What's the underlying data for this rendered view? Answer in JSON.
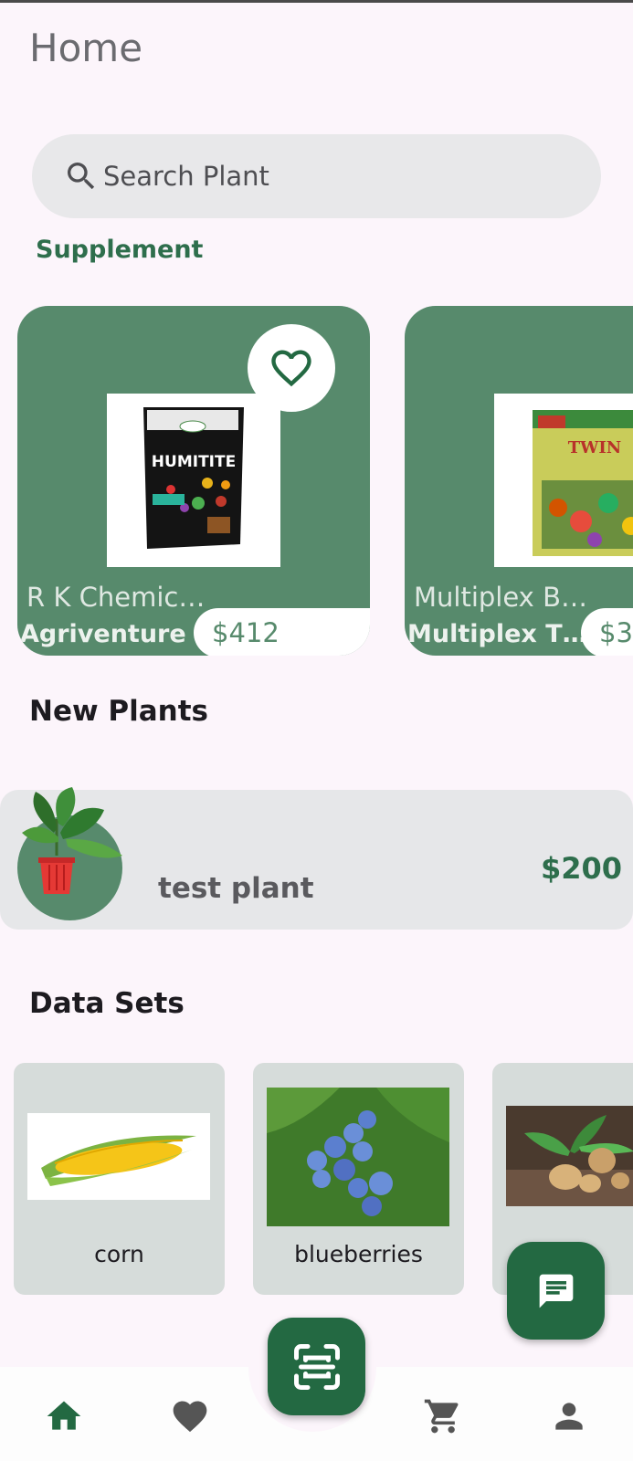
{
  "header": {
    "title": "Home"
  },
  "search": {
    "placeholder": "Search Plant"
  },
  "supplement": {
    "label": "Supplement",
    "cards": [
      {
        "brand": "R K Chemic…",
        "name": "Agriventure …",
        "price": "$412",
        "image_text": "HUMITITE"
      },
      {
        "brand": "Multiplex B…",
        "name": "Multiplex T…",
        "price": "$3",
        "image_text": "TWIN"
      }
    ]
  },
  "new_plants": {
    "label": "New Plants",
    "items": [
      {
        "name": "test plant",
        "price": "$200"
      }
    ]
  },
  "data_sets": {
    "label": "Data Sets",
    "items": [
      {
        "name": "corn"
      },
      {
        "name": "blueberries"
      },
      {
        "name": "potato"
      }
    ]
  },
  "colors": {
    "accent": "#236942",
    "card": "#578a6c",
    "background": "#fcf5fb"
  },
  "icons": {
    "search": "search-icon",
    "favorite": "heart-outline-icon",
    "chat": "chat-icon",
    "scan": "scan-icon",
    "home": "home-icon",
    "wishlist": "heart-icon",
    "cart": "cart-icon",
    "profile": "person-icon"
  }
}
